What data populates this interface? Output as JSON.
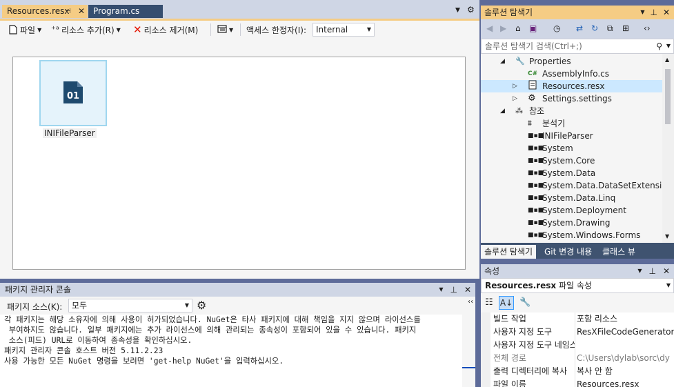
{
  "doc_tabs": {
    "active": "Resources.resx",
    "inactive": "Program.cs"
  },
  "resx_toolbar": {
    "file_label": "파일",
    "add_resource_label": "리소스 추가(R)",
    "remove_resource_label": "리소스 제거(M)",
    "access_modifier_label": "액세스 한정자(I):",
    "access_modifier_value": "Internal"
  },
  "resources": [
    {
      "name": "INIFileParser",
      "icon_text": "01"
    }
  ],
  "package_console": {
    "title": "패키지 관리자 콘솔",
    "source_label": "패키지 소스(K):",
    "source_value": "모두",
    "output_lines": [
      "각 패키지는 해당 소유자에 의해 사용이 허가되었습니다. NuGet은 타사 패키지에 대해 책임을 지지 않으며 라이선스를",
      " 부여하지도 않습니다. 일부 패키지에는 추가 라이선스에 의해 관리되는 종속성이 포함되어 있을 수 있습니다. 패키지",
      " 소스(피드) URL로 이동하여 종속성을 확인하십시오.",
      "",
      "패키지 관리자 콘솔 호스트 버전 5.11.2.23",
      "",
      "사용 가능한 모든 NuGet 명령을 보려면 'get-help NuGet'을 입력하십시오."
    ]
  },
  "solution_explorer": {
    "title": "솔루션 탐색기",
    "search_placeholder": "솔루션 탐색기 검색(Ctrl+;)",
    "tree": [
      {
        "label": "Properties",
        "icon": "wrench-icon",
        "level": 1,
        "expander": "expanded"
      },
      {
        "label": "AssemblyInfo.cs",
        "icon": "csharp-file-icon",
        "level": 2,
        "expander": "none"
      },
      {
        "label": "Resources.resx",
        "icon": "resx-file-icon",
        "level": 2,
        "expander": "collapsed",
        "selected": true
      },
      {
        "label": "Settings.settings",
        "icon": "settings-gear-icon",
        "level": 2,
        "expander": "collapsed"
      },
      {
        "label": "참조",
        "icon": "references-icon",
        "level": 1,
        "expander": "expanded"
      },
      {
        "label": "분석기",
        "icon": "analyzer-icon",
        "level": 2,
        "expander": "none"
      },
      {
        "label": "INIFileParser",
        "icon": "reference-icon",
        "level": 2,
        "expander": "none"
      },
      {
        "label": "System",
        "icon": "reference-icon",
        "level": 2,
        "expander": "none"
      },
      {
        "label": "System.Core",
        "icon": "reference-icon",
        "level": 2,
        "expander": "none"
      },
      {
        "label": "System.Data",
        "icon": "reference-icon",
        "level": 2,
        "expander": "none"
      },
      {
        "label": "System.Data.DataSetExtensions",
        "icon": "reference-icon",
        "level": 2,
        "expander": "none"
      },
      {
        "label": "System.Data.Linq",
        "icon": "reference-icon",
        "level": 2,
        "expander": "none"
      },
      {
        "label": "System.Deployment",
        "icon": "reference-icon",
        "level": 2,
        "expander": "none"
      },
      {
        "label": "System.Drawing",
        "icon": "reference-icon",
        "level": 2,
        "expander": "none"
      },
      {
        "label": "System.Windows.Forms",
        "icon": "reference-icon",
        "level": 2,
        "expander": "none"
      }
    ],
    "bottom_tabs": [
      "솔루션 탐색기",
      "Git 변경 내용",
      "클래스 뷰"
    ]
  },
  "properties": {
    "title": "속성",
    "object_name": "Resources.resx",
    "object_type": "파일 속성",
    "rows": [
      {
        "name": "빌드 작업",
        "value": "포함 리소스",
        "disabled": false
      },
      {
        "name": "사용자 지정 도구",
        "value": "ResXFileCodeGenerator",
        "disabled": false
      },
      {
        "name": "사용자 지정 도구 네임스페이스",
        "value": "",
        "disabled": false
      },
      {
        "name": "전체 경로",
        "value": "C:\\Users\\dylab\\sorc\\dy",
        "disabled": true
      },
      {
        "name": "출력 디렉터리에 복사",
        "value": "복사 안 함",
        "disabled": false
      },
      {
        "name": "파일 이름",
        "value": "Resources.resx",
        "disabled": false
      }
    ]
  },
  "colors": {
    "accent_active": "#f5cc84",
    "panel_header": "#cfd6e5",
    "selection": "#cce8ff",
    "frame": "#5d6b99"
  }
}
